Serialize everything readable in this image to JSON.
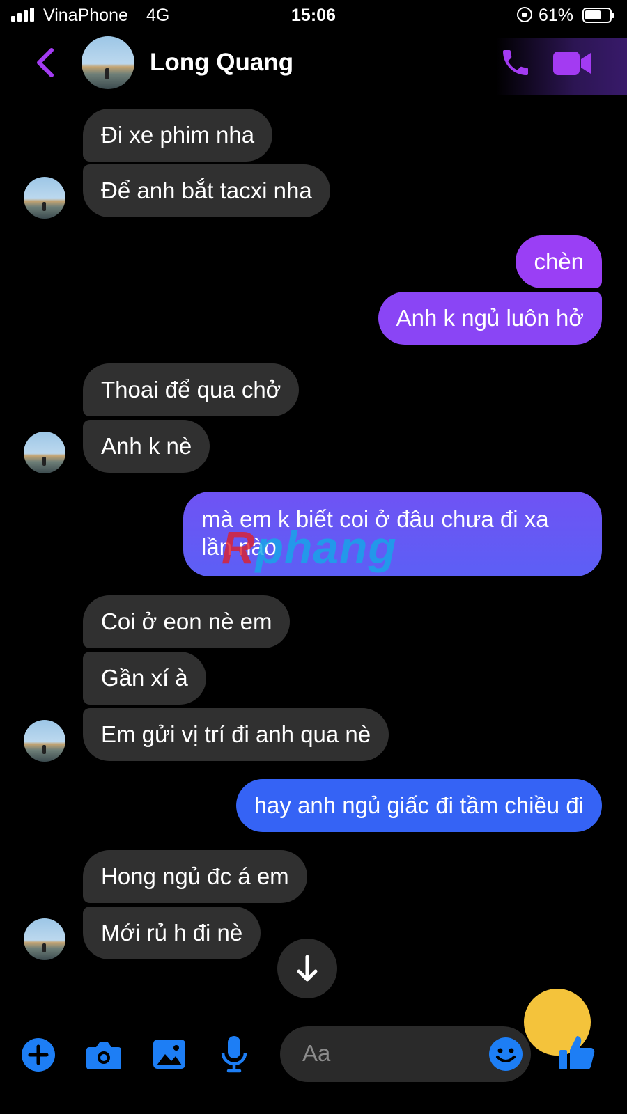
{
  "status_bar": {
    "carrier": "VinaPhone",
    "network": "4G",
    "time": "15:06",
    "battery_percent": "61%"
  },
  "header": {
    "contact_name": "Long Quang",
    "icons": [
      "back-chevron-icon",
      "phone-icon",
      "video-camera-icon"
    ],
    "accent_color": "#a33bf2"
  },
  "messages": [
    {
      "direction": "incoming",
      "text": "Đi xe phim nha"
    },
    {
      "direction": "incoming",
      "text": "Để anh bắt tacxi nha"
    },
    {
      "direction": "outgoing",
      "text": "chèn"
    },
    {
      "direction": "outgoing",
      "text": "Anh k ngủ luôn hở"
    },
    {
      "direction": "incoming",
      "text": "Thoai để qua chở"
    },
    {
      "direction": "incoming",
      "text": "Anh k nè"
    },
    {
      "direction": "outgoing",
      "text": "mà em k biết coi ở đâu chưa đi xa lần nào"
    },
    {
      "direction": "incoming",
      "text": "Coi ở eon nè em"
    },
    {
      "direction": "incoming",
      "text": "Gần xí à"
    },
    {
      "direction": "incoming",
      "text": "Em gửi vị trí đi anh qua nè"
    },
    {
      "direction": "outgoing",
      "text": "hay anh ngủ giấc đi tầm chiều đi"
    },
    {
      "direction": "incoming",
      "text": "Hong ngủ đc á em"
    },
    {
      "direction": "incoming",
      "text": "Mới rủ h đi nè"
    }
  ],
  "watermark": {
    "initial": "R",
    "rest": "phang"
  },
  "composer": {
    "placeholder": "Aa",
    "icons": [
      "plus-icon",
      "camera-icon",
      "image-icon",
      "microphone-icon",
      "emoji-icon",
      "thumbs-up-icon"
    ],
    "icon_color": "#1d7ef5"
  },
  "colors": {
    "incoming_bubble": "#303030",
    "outgoing_bubble_top": "#9a3ff5",
    "outgoing_bubble_bottom": "#2f6cf5"
  }
}
